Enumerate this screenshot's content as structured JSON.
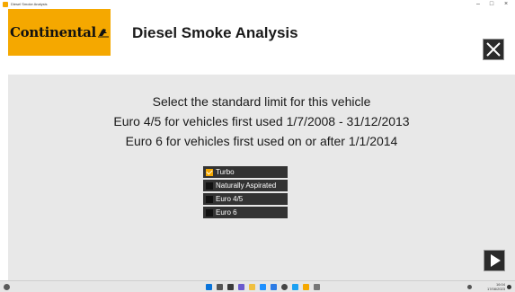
{
  "window": {
    "title": "Diesel Smoke Analysis",
    "minimize_glyph": "–",
    "maximize_glyph": "□",
    "close_glyph": "×"
  },
  "header": {
    "logo_text": "Continental",
    "logo_color": "#f5a800",
    "title": "Diesel Smoke Analysis",
    "close_icon": "close-icon"
  },
  "instructions": {
    "line1": "Select the standard limit for this vehicle",
    "line2": "Euro 4/5 for vehicles first used 1/7/2008 - 31/12/2013",
    "line3": "Euro 6 for vehicles first used on or after 1/1/2014"
  },
  "options": [
    {
      "label": "Turbo",
      "checked": true
    },
    {
      "label": "Naturally Aspirated",
      "checked": false
    },
    {
      "label": "Euro 4/5",
      "checked": false
    },
    {
      "label": "Euro 6",
      "checked": false
    }
  ],
  "next_icon": "play-arrow-icon",
  "taskbar": {
    "time": "16:04",
    "date": "17/08/2023"
  }
}
